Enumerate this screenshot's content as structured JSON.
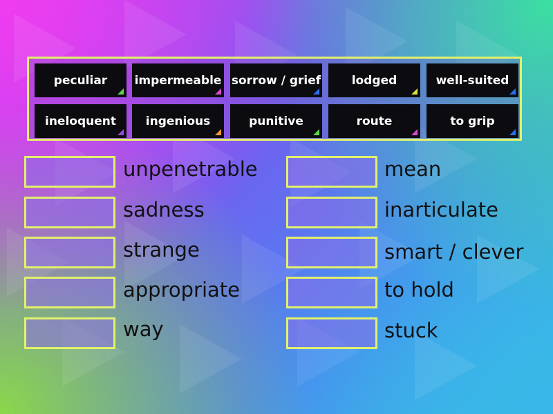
{
  "colors": {
    "frame": "#e2f26a",
    "tile_bg": "#0c0c10",
    "corner_green": "#5fd44a",
    "corner_pink": "#d84ad0",
    "corner_blue": "#2a6ef0",
    "corner_yellow": "#d8e040",
    "corner_purple": "#9a4ae0",
    "corner_orange": "#f09a30"
  },
  "tiles": [
    {
      "label": "peculiar",
      "corner": "#5fd44a"
    },
    {
      "label": "impermeable",
      "corner": "#d84ad0"
    },
    {
      "label": "sorrow / grief",
      "corner": "#2a6ef0"
    },
    {
      "label": "lodged",
      "corner": "#d8e040"
    },
    {
      "label": "well-suited",
      "corner": "#2a6ef0"
    },
    {
      "label": "ineloquent",
      "corner": "#9a4ae0"
    },
    {
      "label": "ingenious",
      "corner": "#f09a30"
    },
    {
      "label": "punitive",
      "corner": "#5fd44a"
    },
    {
      "label": "route",
      "corner": "#d84ad0"
    },
    {
      "label": "to grip",
      "corner": "#2a6ef0"
    }
  ],
  "clues_left": [
    "unpenetrable",
    "sadness",
    "strange",
    "appropriate",
    "way"
  ],
  "clues_right": [
    "mean",
    "inarticulate",
    "smart / clever",
    "to hold",
    "stuck"
  ]
}
